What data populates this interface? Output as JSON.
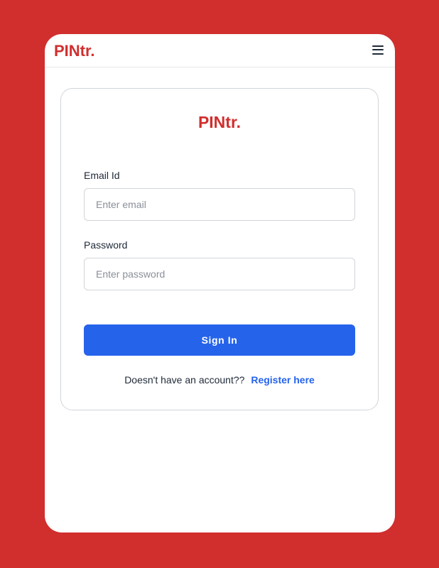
{
  "navbar": {
    "logo": "PINtr.",
    "menu_icon": "hamburger-menu-icon"
  },
  "login_card": {
    "title": "PINtr.",
    "email": {
      "label": "Email Id",
      "placeholder": "Enter email",
      "value": ""
    },
    "password": {
      "label": "Password",
      "placeholder": "Enter password",
      "value": ""
    },
    "submit_label": "Sign In",
    "register_prompt": "Doesn't have an account??",
    "register_link": "Register here"
  },
  "colors": {
    "brand": "#d12e2e",
    "primary": "#2563eb",
    "background": "#d12e2e"
  }
}
